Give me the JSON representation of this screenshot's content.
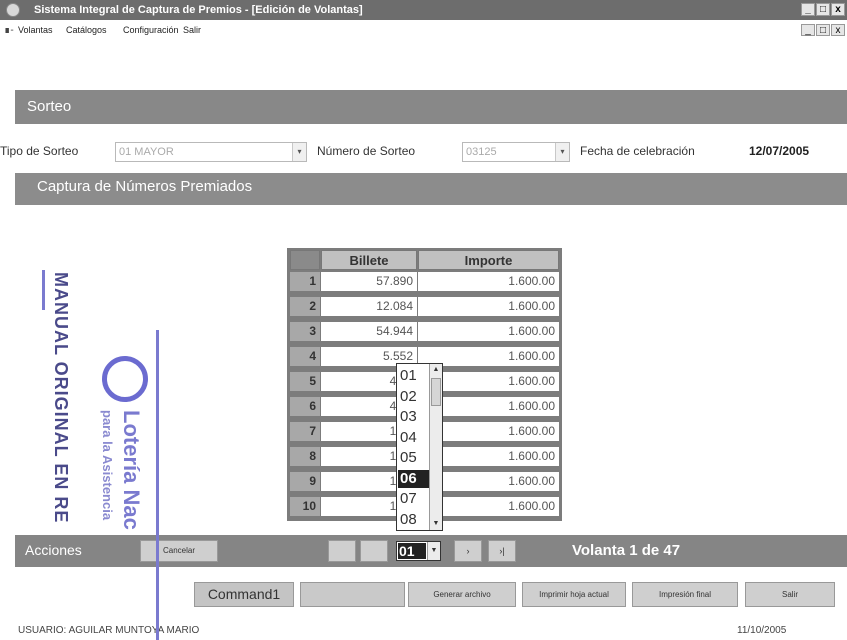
{
  "window": {
    "title": "Sistema Integral de Captura de Premios - [Edición de Volantas]",
    "buttons": [
      "_",
      "3",
      "x"
    ]
  },
  "menu": {
    "items": [
      "Volantas",
      "Catálogos",
      "Configuración",
      "Salir"
    ]
  },
  "sorteo": {
    "heading": "Sorteo",
    "tipo_label": "Tipo de Sorteo",
    "tipo_value": "01 MAYOR",
    "numero_label": "Número de Sorteo",
    "numero_value": "03125",
    "fecha_label": "Fecha de celebración",
    "fecha_value": "12/07/2005"
  },
  "captura": {
    "heading": "Captura de Números Premiados"
  },
  "grid": {
    "headers": {
      "billete": "Billete",
      "importe": "Importe"
    },
    "rows": [
      {
        "n": "1",
        "billete": "57.890",
        "importe": "1.600.00"
      },
      {
        "n": "2",
        "billete": "12.084",
        "importe": "1.600.00"
      },
      {
        "n": "3",
        "billete": "54.944",
        "importe": "1.600.00"
      },
      {
        "n": "4",
        "billete": "5.552",
        "importe": "1.600.00"
      },
      {
        "n": "5",
        "billete": "49.9",
        "importe": "1.600.00"
      },
      {
        "n": "6",
        "billete": "40.0",
        "importe": "1.600.00"
      },
      {
        "n": "7",
        "billete": "19.1",
        "importe": "1.600.00"
      },
      {
        "n": "8",
        "billete": "10.4",
        "importe": "1.600.00"
      },
      {
        "n": "9",
        "billete": "16.4",
        "importe": "1.600.00"
      },
      {
        "n": "10",
        "billete": "16.7",
        "importe": "1.600.00"
      }
    ]
  },
  "dropdown": {
    "options": [
      "01",
      "02",
      "03",
      "04",
      "05",
      "06",
      "07",
      "08"
    ],
    "selected": "06"
  },
  "acciones": {
    "label": "Acciones",
    "cancel": "Cancelar",
    "nav_next": "›",
    "nav_last": "›|",
    "page_value": "01",
    "volanta": "Volanta 1 de 47"
  },
  "commands": {
    "command1": "Command1",
    "generar": "Generar archivo",
    "imprimir_hoja": "Imprimir hoja actual",
    "impresion_final": "Impresión final",
    "salir": "Salir"
  },
  "status": {
    "user": "USUARIO: AGUILAR MUNTOYA MARIO",
    "date": "11/10/2005"
  },
  "stamp": {
    "manual": "MANUAL ORIGINAL EN RE",
    "loteria": "Lotería Nac",
    "para": "para la Asistencia"
  }
}
